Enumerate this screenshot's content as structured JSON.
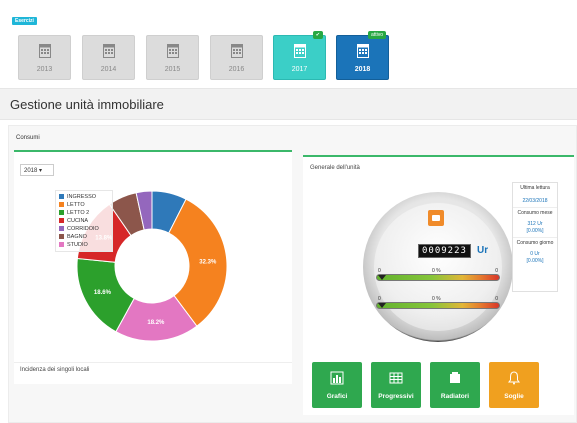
{
  "header": {
    "esercizi_badge": "Esercizi",
    "years": [
      {
        "label": "2013",
        "state": "past"
      },
      {
        "label": "2014",
        "state": "past"
      },
      {
        "label": "2015",
        "state": "past"
      },
      {
        "label": "2016",
        "state": "past"
      },
      {
        "label": "2017",
        "state": "closed",
        "badge": "✔"
      },
      {
        "label": "2018",
        "state": "active",
        "badge": "attivo"
      }
    ]
  },
  "page": {
    "title": "Gestione unità immobiliare"
  },
  "consumi": {
    "section_label": "Consumi",
    "year_select": "2018 ▾",
    "legend": [
      {
        "label": "INGRESSO",
        "color": "#2f79b9"
      },
      {
        "label": "LETTO",
        "color": "#f5821f"
      },
      {
        "label": "LETTO 2",
        "color": "#2ca02c"
      },
      {
        "label": "CUCINA",
        "color": "#d62728"
      },
      {
        "label": "CORRIDOIO",
        "color": "#9467bd"
      },
      {
        "label": "BAGNO",
        "color": "#8c564b"
      },
      {
        "label": "STUDIO",
        "color": "#e377c2"
      }
    ],
    "slice_labels": {
      "letto": "32.3%",
      "studio": "18.2%",
      "letto2": "18.6%",
      "cucina": "13.8%"
    },
    "caption": "Incidenza dei singoli locali"
  },
  "chart_data": {
    "type": "pie",
    "categories": [
      "INGRESSO",
      "LETTO",
      "STUDIO",
      "LETTO 2",
      "CUCINA",
      "BAGNO",
      "CORRIDOIO"
    ],
    "values": [
      7.5,
      32.3,
      18.2,
      18.6,
      13.8,
      6.2,
      3.4
    ]
  },
  "generale": {
    "title": "Generale dell'unità",
    "counter": "0009223",
    "unit": "Ur",
    "bar1": {
      "low": "0",
      "mid": "0 %",
      "high": "0"
    },
    "bar2": {
      "low": "0",
      "mid": "0 %",
      "high": "0"
    },
    "info": [
      {
        "label": "Ultima lettura",
        "value": "22/03/2018"
      },
      {
        "label": "Consumo mese",
        "value": "312 Ur",
        "value2": "[0.00%]"
      },
      {
        "label": "Consumo giorno",
        "value": "0 Ur",
        "value2": "[0.00%]"
      }
    ]
  },
  "actions": [
    {
      "label": "Grafici",
      "icon": "bar-chart-icon",
      "color": "#2fa84f"
    },
    {
      "label": "Progressivi",
      "icon": "table-icon",
      "color": "#2fa84f"
    },
    {
      "label": "Radiatori",
      "icon": "radiator-icon",
      "color": "#2fa84f"
    },
    {
      "label": "Soglie",
      "icon": "bell-icon",
      "color": "#f0a01f"
    }
  ]
}
